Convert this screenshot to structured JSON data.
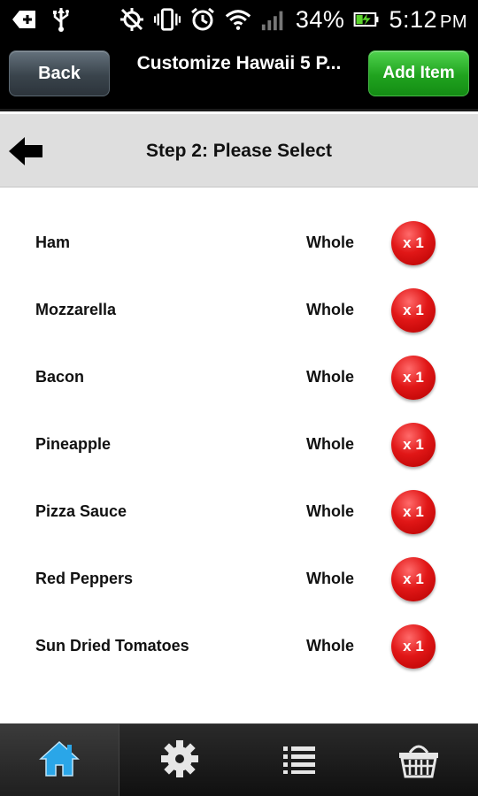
{
  "status_bar": {
    "battery_percent": "34%",
    "time": "5:12",
    "ampm": "PM"
  },
  "header": {
    "back_label": "Back",
    "title": "Customize Hawaii 5 P...",
    "add_label": "Add Item"
  },
  "step": {
    "title": "Step 2: Please Select"
  },
  "items": [
    {
      "name": "Ham",
      "portion": "Whole",
      "qty": "x 1"
    },
    {
      "name": "Mozzarella",
      "portion": "Whole",
      "qty": "x 1"
    },
    {
      "name": "Bacon",
      "portion": "Whole",
      "qty": "x 1"
    },
    {
      "name": "Pineapple",
      "portion": "Whole",
      "qty": "x 1"
    },
    {
      "name": "Pizza Sauce",
      "portion": "Whole",
      "qty": "x 1"
    },
    {
      "name": "Red Peppers",
      "portion": "Whole",
      "qty": "x 1"
    },
    {
      "name": "Sun Dried Tomatoes",
      "portion": "Whole",
      "qty": "x 1"
    }
  ],
  "bottom_nav": [
    {
      "icon": "home-icon",
      "active": true
    },
    {
      "icon": "gear-icon",
      "active": false
    },
    {
      "icon": "list-icon",
      "active": false
    },
    {
      "icon": "basket-icon",
      "active": false
    }
  ],
  "colors": {
    "add_button": "#22a822",
    "qty_badge": "#d81414",
    "home_icon": "#2aa6e8",
    "step_bar": "#dedede"
  }
}
